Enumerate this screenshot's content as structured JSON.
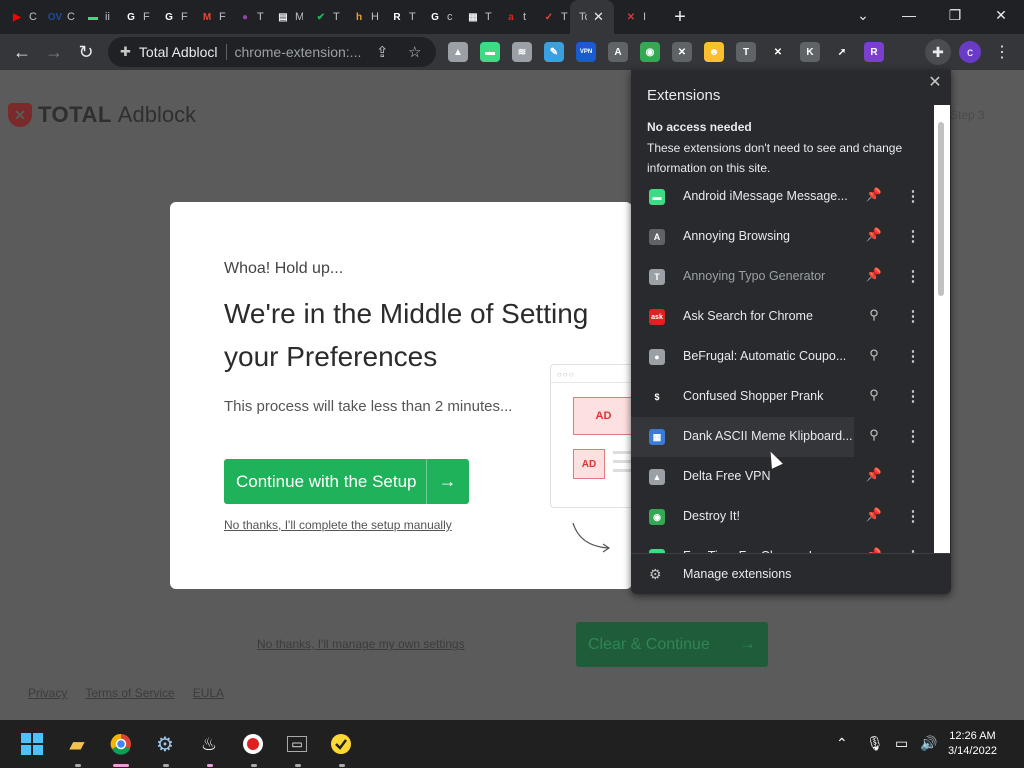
{
  "tabs": [
    {
      "char": "C",
      "icon": "youtube-icon",
      "color": "#ff0000",
      "glyph": "▶"
    },
    {
      "char": "C",
      "icon": "ov-icon",
      "color": "#1a4ea0",
      "glyph": "OV"
    },
    {
      "char": "ii",
      "icon": "messages-icon",
      "color": "#3ddc84",
      "glyph": "▬"
    },
    {
      "char": "F",
      "icon": "google-icon",
      "color": "#ffffff",
      "glyph": "G"
    },
    {
      "char": "F",
      "icon": "google-icon",
      "color": "#ffffff",
      "glyph": "G"
    },
    {
      "char": "F",
      "icon": "gmail-icon",
      "color": "#ea4335",
      "glyph": "M"
    },
    {
      "char": "T",
      "icon": "podcast-icon",
      "color": "#8e44ad",
      "glyph": "●"
    },
    {
      "char": "M",
      "icon": "docs-icon",
      "color": "#e8eaed",
      "glyph": "▤"
    },
    {
      "char": "T",
      "icon": "check-icon",
      "color": "#1fb25a",
      "glyph": "✔"
    },
    {
      "char": "H",
      "icon": "hive-icon",
      "color": "#f0a030",
      "glyph": "h"
    },
    {
      "char": "T",
      "icon": "r-icon",
      "color": "#ffffff",
      "glyph": "R"
    },
    {
      "char": "c",
      "icon": "google-icon",
      "color": "#ffffff",
      "glyph": "G"
    },
    {
      "char": "T",
      "icon": "store-icon",
      "color": "#e8eaed",
      "glyph": "▦"
    },
    {
      "char": "t",
      "icon": "ask-icon",
      "color": "#d22",
      "glyph": "a"
    },
    {
      "char": "T",
      "icon": "checkmark-red-icon",
      "color": "#e8453c",
      "glyph": "✓"
    },
    {
      "char": "Tc",
      "icon": "",
      "color": "",
      "glyph": ""
    },
    {
      "char": "I",
      "icon": "shield-icon",
      "color": "#d9363e",
      "glyph": "✕"
    }
  ],
  "window": {
    "minimize": "—",
    "restore": "❐",
    "close": "✕",
    "new_tab": "+",
    "tab_search": "⌄"
  },
  "omnibox": {
    "site": "Total Adblocl",
    "url": "chrome-extension:..."
  },
  "toolbar_extensions": [
    {
      "icon": "triangle-icon",
      "color": "#9aa0a6",
      "glyph": "▲"
    },
    {
      "icon": "messages-icon",
      "color": "#3ddc84",
      "glyph": "▬"
    },
    {
      "icon": "wifi-icon",
      "color": "#9aa0a6",
      "glyph": "≋"
    },
    {
      "icon": "pen-icon",
      "color": "#3aa0e0",
      "glyph": "✎"
    },
    {
      "icon": "vpn-icon",
      "color": "#1a5bd0",
      "glyph": "VPN"
    },
    {
      "icon": "annoying-a-icon",
      "color": "#5f6368",
      "glyph": "A"
    },
    {
      "icon": "destroy-icon",
      "color": "#34a853",
      "glyph": "◉"
    },
    {
      "icon": "tools-icon",
      "color": "#5f6368",
      "glyph": "✕"
    },
    {
      "icon": "emoji-icon",
      "color": "#fbc02d",
      "glyph": "☻"
    },
    {
      "icon": "typo-icon",
      "color": "#5f6368",
      "glyph": "T"
    },
    {
      "icon": "cross-icon",
      "color": "#35363a",
      "glyph": "✕"
    },
    {
      "icon": "k-icon",
      "color": "#5f6368",
      "glyph": "K"
    },
    {
      "icon": "arrow-icon",
      "color": "#35363a",
      "glyph": "➚"
    },
    {
      "icon": "r-purple-icon",
      "color": "#7b3fd0",
      "glyph": "R"
    }
  ],
  "avatar": "c",
  "page": {
    "logo_bold": "TOTAL",
    "logo_thin": "Adblock",
    "step": "Step 3",
    "modal": {
      "kicker": "Whoa! Hold up...",
      "headline": "We're in the Middle of Setting your Preferences",
      "sub": "This process will take less than 2 minutes...",
      "cta": "Continue with the Setup",
      "manual": "No thanks, I'll complete the setup manually",
      "ad1": "AD",
      "ad2": "AD"
    },
    "bg_link": "No thanks, I'll manage my own settings",
    "clear_button": "Clear & Continue",
    "footer": [
      "Privacy",
      "Terms of Service",
      "EULA"
    ]
  },
  "extensions_panel": {
    "title": "Extensions",
    "section_title": "No access needed",
    "section_desc": "These extensions don't need to see and change information on this site.",
    "items": [
      {
        "name": "Android iMessage Message...",
        "icon": "messages-icon",
        "color": "#3ddc84",
        "glyph": "▬",
        "pinned": true,
        "dim": false
      },
      {
        "name": "Annoying Browsing",
        "icon": "annoying-a-icon",
        "color": "#5f6368",
        "glyph": "A",
        "pinned": true,
        "dim": false
      },
      {
        "name": "Annoying Typo Generator",
        "icon": "typo-icon",
        "color": "#9aa0a6",
        "glyph": "T",
        "pinned": true,
        "dim": true
      },
      {
        "name": "Ask Search for Chrome",
        "icon": "ask-icon",
        "color": "#d22",
        "glyph": "ask",
        "pinned": false,
        "dim": false
      },
      {
        "name": "BeFrugal: Automatic Coupo...",
        "icon": "piggy-icon",
        "color": "#9aa0a6",
        "glyph": "●",
        "pinned": false,
        "dim": false
      },
      {
        "name": "Confused Shopper Prank",
        "icon": "dollar-icon",
        "color": "#292a2d",
        "glyph": "$",
        "pinned": false,
        "dim": false
      },
      {
        "name": "Dank ASCII Meme Klipboard...",
        "icon": "meme-icon",
        "color": "#3a7bd5",
        "glyph": "▦",
        "pinned": false,
        "dim": false
      },
      {
        "name": "Delta Free VPN",
        "icon": "delta-icon",
        "color": "#9aa0a6",
        "glyph": "▲",
        "pinned": true,
        "dim": false
      },
      {
        "name": "Destroy It!",
        "icon": "destroy-icon",
        "color": "#34a853",
        "glyph": "◉",
        "pinned": true,
        "dim": false
      },
      {
        "name": "Fun Time For Chrome Lovers",
        "icon": "fun-icon",
        "color": "#3ddc84",
        "glyph": "▬",
        "pinned": true,
        "dim": false
      }
    ],
    "manage": "Manage extensions"
  },
  "taskbar": {
    "time": "12:26 AM",
    "date": "3/14/2022"
  }
}
